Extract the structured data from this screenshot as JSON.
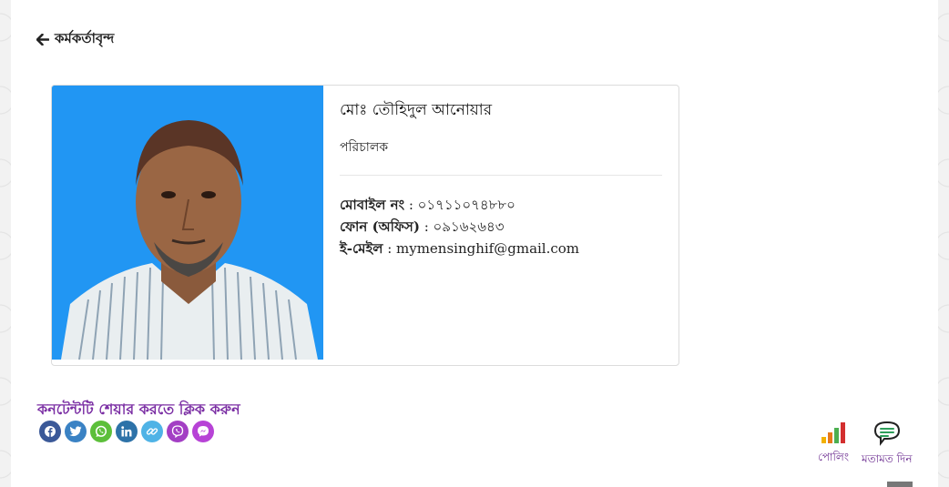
{
  "nav": {
    "back_label": "কর্মকর্তাবৃন্দ",
    "back_icon": "arrow-left-icon"
  },
  "profile": {
    "photo_bg": "#2196f3",
    "name": "মোঃ তৌহিদুল আনোয়ার",
    "designation": "পরিচালক",
    "mobile_label": "মোবাইল নং",
    "mobile_value": " : ০১৭১১০৭৪৮৮০",
    "phone_label": "ফোন (অফিস)",
    "phone_value": " : ০৯১৬২৬৪৩",
    "email_label": "ই-মেইল",
    "email_value": " : mymensinghif@gmail.com"
  },
  "share": {
    "title": "কনটেন্টটি শেয়ার করতে ক্লিক করুন",
    "buttons": [
      {
        "name": "facebook",
        "icon": "facebook-icon",
        "color": "#3b5998"
      },
      {
        "name": "twitter",
        "icon": "twitter-icon",
        "color": "#3a82c4"
      },
      {
        "name": "whatsapp",
        "icon": "whatsapp-icon",
        "color": "#5cbf3a"
      },
      {
        "name": "linkedin",
        "icon": "linkedin-icon",
        "color": "#2d72a8"
      },
      {
        "name": "copy-link",
        "icon": "link-icon",
        "color": "#4fb3e6"
      },
      {
        "name": "viber",
        "icon": "viber-icon",
        "color": "#a33fc4"
      },
      {
        "name": "messenger",
        "icon": "messenger-icon",
        "color": "#b743d6"
      }
    ]
  },
  "widgets": {
    "poll_label": "পোলিং",
    "poll_icon": "bar-chart-icon",
    "feedback_label": "মতামত দিন",
    "feedback_icon": "chat-bubble-icon"
  },
  "colors": {
    "accent": "#7b2fa4",
    "widget_label": "#6a2a8f"
  }
}
